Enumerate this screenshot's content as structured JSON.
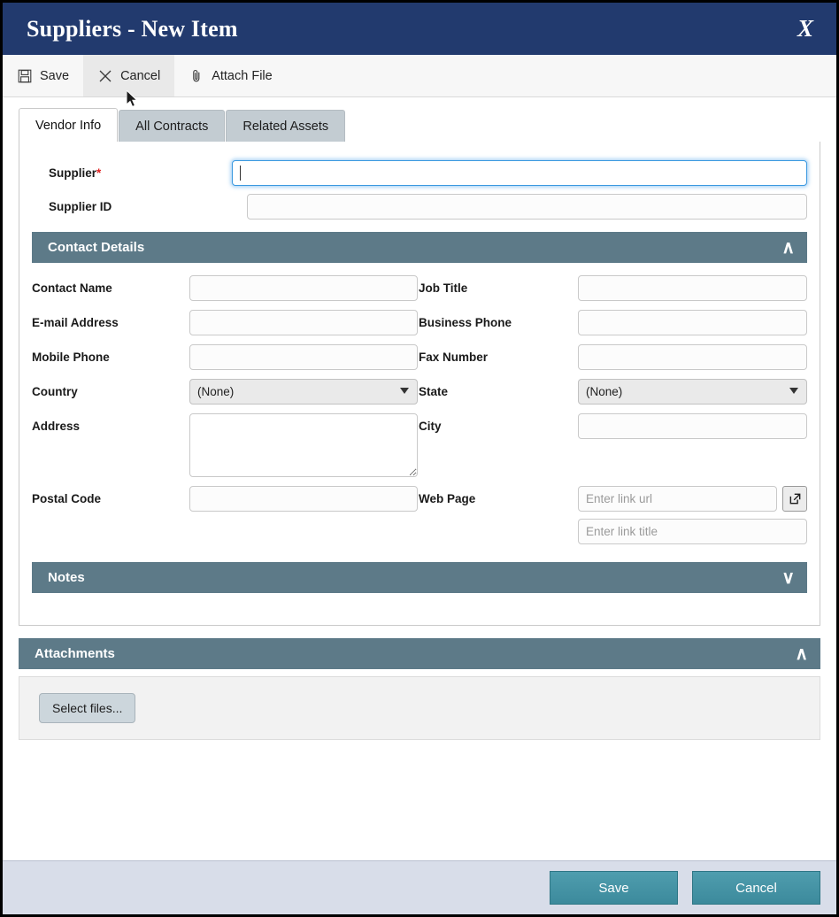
{
  "window": {
    "title": "Suppliers - New Item",
    "close_label": "X"
  },
  "toolbar": {
    "save_label": "Save",
    "cancel_label": "Cancel",
    "attach_label": "Attach File",
    "icons": [
      "save-floppy-icon",
      "close-x-icon",
      "paperclip-icon"
    ]
  },
  "tabs": [
    {
      "label": "Vendor Info",
      "active": true
    },
    {
      "label": "All Contracts",
      "active": false
    },
    {
      "label": "Related Assets",
      "active": false
    }
  ],
  "top_fields": {
    "supplier_label": "Supplier",
    "supplier_required_mark": "*",
    "supplier_value": "",
    "supplier_id_label": "Supplier ID",
    "supplier_id_value": ""
  },
  "contact_details": {
    "header": "Contact Details",
    "collapsed": false,
    "chevron": "∧",
    "left": [
      {
        "label": "Contact Name",
        "value": "",
        "type": "text"
      },
      {
        "label": "E-mail Address",
        "value": "",
        "type": "text"
      },
      {
        "label": "Mobile Phone",
        "value": "",
        "type": "text"
      },
      {
        "label": "Country",
        "value": "(None)",
        "type": "select"
      },
      {
        "label": "Address",
        "value": "",
        "type": "textarea"
      },
      {
        "label": "Postal Code",
        "value": "",
        "type": "text"
      }
    ],
    "right": [
      {
        "label": "Job Title",
        "value": "",
        "type": "text"
      },
      {
        "label": "Business Phone",
        "value": "",
        "type": "text"
      },
      {
        "label": "Fax Number",
        "value": "",
        "type": "text"
      },
      {
        "label": "State",
        "value": "(None)",
        "type": "select"
      },
      {
        "label": "City",
        "value": "",
        "type": "text"
      },
      {
        "label": "Web Page",
        "value": "",
        "type": "link"
      }
    ],
    "country_value": "(None)",
    "state_value": "(None)",
    "web_page_label": "Web Page",
    "link_url_placeholder": "Enter link url",
    "link_title_placeholder": "Enter link title",
    "link_url_value": "",
    "link_title_value": ""
  },
  "notes": {
    "header": "Notes",
    "collapsed": true,
    "chevron": "∨"
  },
  "attachments": {
    "header": "Attachments",
    "collapsed": false,
    "chevron": "∧",
    "select_files_label": "Select files..."
  },
  "footer": {
    "save_label": "Save",
    "cancel_label": "Cancel"
  },
  "colors": {
    "titlebar": "#223a6e",
    "section_header": "#5d7a88",
    "footer_bg": "#d8dde9",
    "button_teal": "#3d93a5",
    "required_red": "#e02020",
    "tab_inactive": "#c3ccd2",
    "focus_blue": "#3b99e0"
  }
}
